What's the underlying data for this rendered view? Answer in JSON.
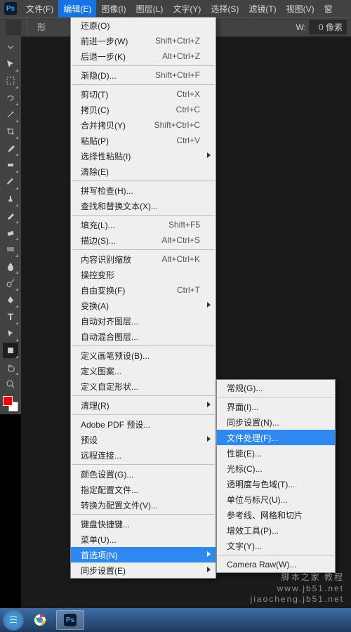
{
  "menubar": {
    "items": [
      "文件(F)",
      "编辑(E)",
      "图像(I)",
      "图层(L)",
      "文字(Y)",
      "选择(S)",
      "滤镜(T)",
      "视图(V)",
      "窗"
    ],
    "active_index": 1
  },
  "optbar": {
    "shape_label": "形",
    "w_label": "W:",
    "w_value": "0 像素"
  },
  "edit_menu": [
    {
      "label": "还原(O)"
    },
    {
      "label": "前进一步(W)",
      "shortcut": "Shift+Ctrl+Z"
    },
    {
      "label": "后退一步(K)",
      "shortcut": "Alt+Ctrl+Z"
    },
    {
      "sep": true
    },
    {
      "label": "渐隐(D)...",
      "shortcut": "Shift+Ctrl+F"
    },
    {
      "sep": true
    },
    {
      "label": "剪切(T)",
      "shortcut": "Ctrl+X"
    },
    {
      "label": "拷贝(C)",
      "shortcut": "Ctrl+C"
    },
    {
      "label": "合并拷贝(Y)",
      "shortcut": "Shift+Ctrl+C"
    },
    {
      "label": "粘贴(P)",
      "shortcut": "Ctrl+V"
    },
    {
      "label": "选择性粘贴(I)",
      "arrow": true
    },
    {
      "label": "清除(E)"
    },
    {
      "sep": true
    },
    {
      "label": "拼写检查(H)..."
    },
    {
      "label": "查找和替换文本(X)..."
    },
    {
      "sep": true
    },
    {
      "label": "填充(L)...",
      "shortcut": "Shift+F5"
    },
    {
      "label": "描边(S)...",
      "shortcut": "Alt+Ctrl+S"
    },
    {
      "sep": true
    },
    {
      "label": "内容识别缩放",
      "shortcut": "Alt+Ctrl+K"
    },
    {
      "label": "操控变形"
    },
    {
      "label": "自由变换(F)",
      "shortcut": "Ctrl+T"
    },
    {
      "label": "变换(A)",
      "arrow": true
    },
    {
      "label": "自动对齐图层..."
    },
    {
      "label": "自动混合图层..."
    },
    {
      "sep": true
    },
    {
      "label": "定义画笔预设(B)..."
    },
    {
      "label": "定义图案..."
    },
    {
      "label": "定义自定形状..."
    },
    {
      "sep": true
    },
    {
      "label": "清理(R)",
      "arrow": true
    },
    {
      "sep": true
    },
    {
      "label": "Adobe PDF 预设..."
    },
    {
      "label": "预设",
      "arrow": true
    },
    {
      "label": "远程连接..."
    },
    {
      "sep": true
    },
    {
      "label": "颜色设置(G)..."
    },
    {
      "label": "指定配置文件..."
    },
    {
      "label": "转换为配置文件(V)..."
    },
    {
      "sep": true
    },
    {
      "label": "键盘快捷键..."
    },
    {
      "label": "菜单(U)..."
    },
    {
      "label": "首选项(N)",
      "arrow": true,
      "hl": true
    },
    {
      "label": "同步设置(E)",
      "arrow": true
    }
  ],
  "prefs_submenu": [
    {
      "label": "常规(G)..."
    },
    {
      "sep": true
    },
    {
      "label": "界面(I)..."
    },
    {
      "label": "同步设置(N)..."
    },
    {
      "label": "文件处理(F)...",
      "hl": true
    },
    {
      "label": "性能(E)..."
    },
    {
      "label": "光标(C)..."
    },
    {
      "label": "透明度与色域(T)..."
    },
    {
      "label": "单位与标尺(U)..."
    },
    {
      "label": "参考线、网格和切片"
    },
    {
      "label": "增效工具(P)..."
    },
    {
      "label": "文字(Y)..."
    },
    {
      "sep": true
    },
    {
      "label": "Camera Raw(W)..."
    }
  ],
  "watermark": {
    "line1": "脚本之家 教程",
    "line2": "www.jb51.net",
    "line3": "jiaocheng.jb51.net"
  }
}
